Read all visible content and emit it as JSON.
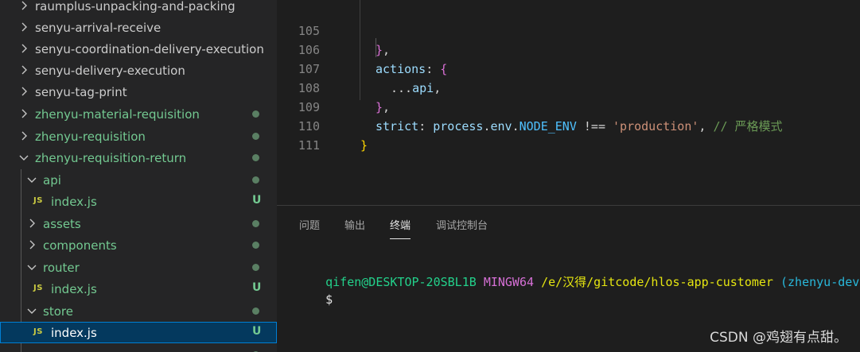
{
  "sidebar": {
    "rows": [
      {
        "label": "raumplus-unpacking-and-packing",
        "status": ""
      },
      {
        "label": "senyu-arrival-receive",
        "status": ""
      },
      {
        "label": "senyu-coordination-delivery-execution",
        "status": ""
      },
      {
        "label": "senyu-delivery-execution",
        "status": ""
      },
      {
        "label": "senyu-tag-print",
        "status": ""
      },
      {
        "label": "zhenyu-material-requisition",
        "status": "dot"
      },
      {
        "label": "zhenyu-requisition",
        "status": "dot"
      },
      {
        "label": "zhenyu-requisition-return",
        "status": "dot"
      },
      {
        "label": "api",
        "status": "dot"
      },
      {
        "label": "index.js",
        "status": "U",
        "badge": "JS"
      },
      {
        "label": "assets",
        "status": "dot"
      },
      {
        "label": "components",
        "status": "dot"
      },
      {
        "label": "router",
        "status": "dot"
      },
      {
        "label": "index.js",
        "status": "U",
        "badge": "JS"
      },
      {
        "label": "store",
        "status": "dot"
      },
      {
        "label": "index.js",
        "status": "U",
        "badge": "JS"
      }
    ]
  },
  "editor": {
    "lines": [
      {
        "num": "105",
        "code": "},"
      },
      {
        "num": "106",
        "code": "actions: {"
      },
      {
        "num": "107",
        "code": "...api,"
      },
      {
        "num": "108",
        "code": "},"
      },
      {
        "num": "109",
        "code": "strict: process.env.NODE_ENV !== 'production', // 严格模式"
      },
      {
        "num": "110",
        "code": "}"
      },
      {
        "num": "111",
        "code": ""
      }
    ]
  },
  "panel": {
    "tabs": [
      "问题",
      "输出",
      "终端",
      "调试控制台"
    ],
    "active_tab": "终端",
    "terminal": {
      "user_host": "qifen@DESKTOP-20SBL1B",
      "env": "MINGW64",
      "path": "/e/汉得/gitcode/hlos-app-customer",
      "branch": "(zhenyu-develop",
      "prompt": "$"
    }
  },
  "watermark": "CSDN @鸡翅有点甜。",
  "colors": {
    "sidebar_bg": "#252526",
    "editor_bg": "#1e1e1e",
    "selection_bg": "#04395e",
    "untracked_green": "#73c991",
    "js_yellow": "#cbcb41"
  },
  "icons": {
    "chevron_right": "chevron-right-icon",
    "chevron_down": "chevron-down-icon",
    "js_file": "js-file-icon"
  }
}
